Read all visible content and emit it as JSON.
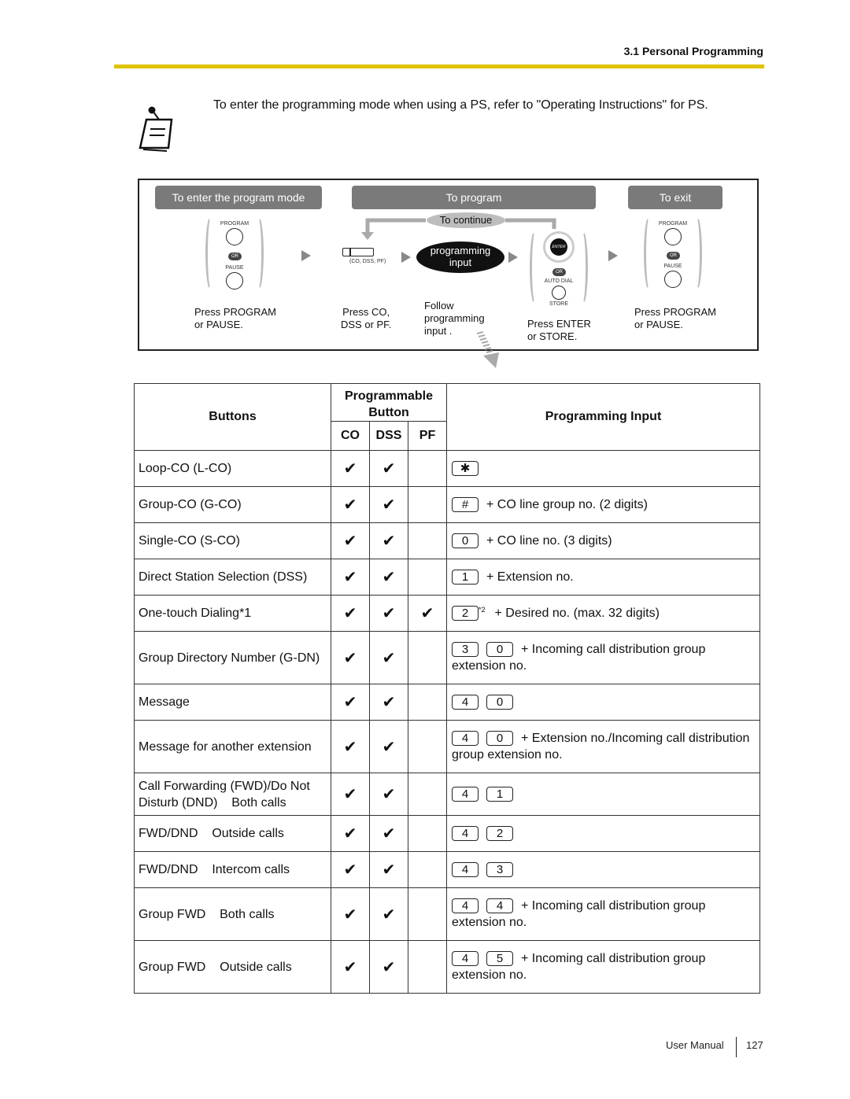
{
  "header": {
    "section_title": "3.1 Personal Programming",
    "accent_color": "#dfc200"
  },
  "note": {
    "icon": "note-pin-icon",
    "text": "To enter the programming mode when using a PS, refer to \"Operating Instructions\" for PS."
  },
  "diagram": {
    "stages": {
      "enter": "To enter the program mode",
      "program": "To program",
      "exit": "To exit"
    },
    "continue_label": "To continue",
    "program_button_label": "PROGRAM",
    "pause_button_label": "PAUSE",
    "or_label": "OR",
    "flex_button_caption": "(CO, DSS, PF)",
    "programming_input_bubble": [
      "programming",
      "input"
    ],
    "enter_key_label": "ENTER",
    "auto_dial_label": "AUTO DIAL",
    "store_label": "STORE",
    "captions": {
      "enter": [
        "Press PROGRAM",
        "or PAUSE."
      ],
      "press_button": [
        "Press CO,",
        "DSS or PF."
      ],
      "follow": [
        "Follow",
        "programming",
        "input ."
      ],
      "press_enter": [
        "Press ENTER",
        "or STORE."
      ],
      "exit": [
        "Press PROGRAM",
        "or PAUSE."
      ]
    }
  },
  "table": {
    "headers": {
      "buttons": "Buttons",
      "programmable": "Programmable Button",
      "co": "CO",
      "dss": "DSS",
      "pf": "PF",
      "input": "Programming Input"
    },
    "check_mark": "✔",
    "rows": [
      {
        "button": "Loop-CO (L-CO)",
        "co": "✔",
        "dss": "✔",
        "pf": "",
        "keys": [
          "✱"
        ],
        "sup": "",
        "input": ""
      },
      {
        "button": "Group-CO (G-CO)",
        "co": "✔",
        "dss": "✔",
        "pf": "",
        "keys": [
          "#"
        ],
        "sup": "",
        "input": "+ CO line group no. (2 digits)"
      },
      {
        "button": "Single-CO (S-CO)",
        "co": "✔",
        "dss": "✔",
        "pf": "",
        "keys": [
          "0"
        ],
        "sup": "",
        "input": "+ CO line no. (3 digits)"
      },
      {
        "button": "Direct Station Selection (DSS)",
        "co": "✔",
        "dss": "✔",
        "pf": "",
        "keys": [
          "1"
        ],
        "sup": "",
        "input": "+ Extension no."
      },
      {
        "button": "One-touch Dialing*1",
        "co": "✔",
        "dss": "✔",
        "pf": "✔",
        "keys": [
          "2"
        ],
        "sup": "*2",
        "input": "+ Desired no. (max. 32 digits)"
      },
      {
        "button": "Group Directory Number (G-DN)",
        "co": "✔",
        "dss": "✔",
        "pf": "",
        "keys": [
          "3",
          "0"
        ],
        "sup": "",
        "input": "+ Incoming call distribution group extension no."
      },
      {
        "button": "Message",
        "co": "✔",
        "dss": "✔",
        "pf": "",
        "keys": [
          "4",
          "0"
        ],
        "sup": "",
        "input": ""
      },
      {
        "button": "Message for another extension",
        "co": "✔",
        "dss": "✔",
        "pf": "",
        "keys": [
          "4",
          "0"
        ],
        "sup": "",
        "input": "+ Extension no./Incoming call distribution group extension no."
      },
      {
        "button": "Call Forwarding (FWD)/Do Not Disturb (DND)    Both calls",
        "co": "✔",
        "dss": "✔",
        "pf": "",
        "keys": [
          "4",
          "1"
        ],
        "sup": "",
        "input": ""
      },
      {
        "button": "FWD/DND    Outside calls",
        "co": "✔",
        "dss": "✔",
        "pf": "",
        "keys": [
          "4",
          "2"
        ],
        "sup": "",
        "input": ""
      },
      {
        "button": "FWD/DND    Intercom calls",
        "co": "✔",
        "dss": "✔",
        "pf": "",
        "keys": [
          "4",
          "3"
        ],
        "sup": "",
        "input": ""
      },
      {
        "button": "Group FWD    Both calls",
        "co": "✔",
        "dss": "✔",
        "pf": "",
        "keys": [
          "4",
          "4"
        ],
        "sup": "",
        "input": "+ Incoming call distribution group extension no."
      },
      {
        "button": "Group FWD    Outside calls",
        "co": "✔",
        "dss": "✔",
        "pf": "",
        "keys": [
          "4",
          "5"
        ],
        "sup": "",
        "input": "+ Incoming call distribution group extension no."
      }
    ]
  },
  "footer": {
    "label": "User Manual",
    "page_number": "127"
  }
}
